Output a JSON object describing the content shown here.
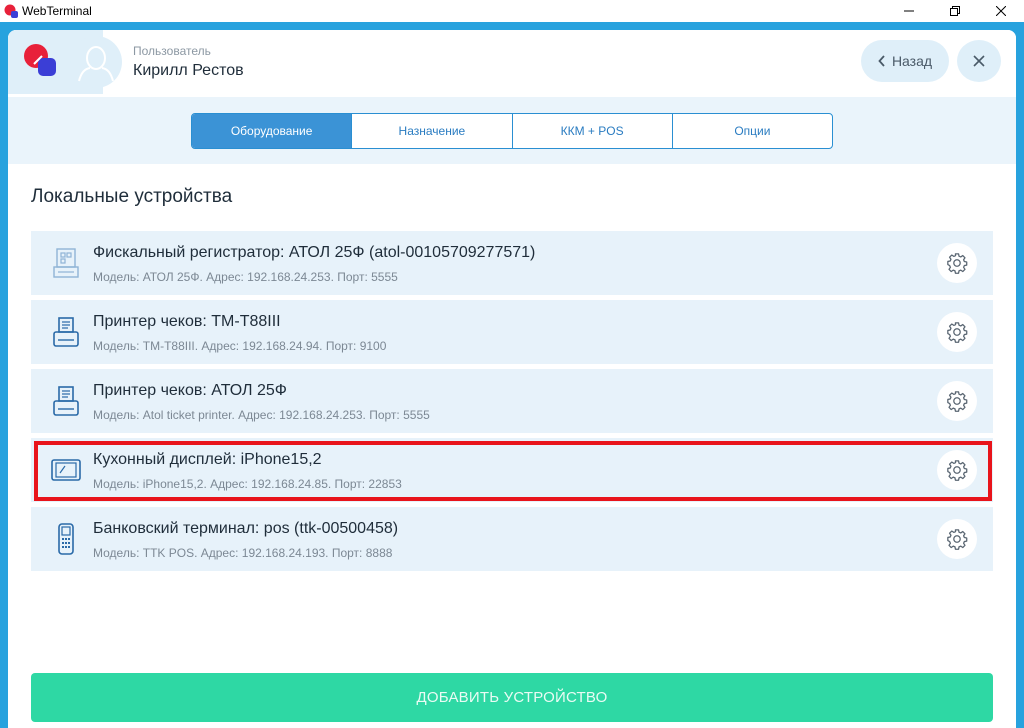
{
  "window": {
    "title": "WebTerminal",
    "minimize_icon": "minimize-icon",
    "maximize_icon": "restore-icon",
    "close_icon": "close-icon"
  },
  "header": {
    "user_label": "Пользователь",
    "user_name": "Кирилл Рестов",
    "back_label": "Назад"
  },
  "tabs": [
    {
      "label": "Оборудование",
      "active": true
    },
    {
      "label": "Назначение",
      "active": false
    },
    {
      "label": "ККМ + POS",
      "active": false
    },
    {
      "label": "Опции",
      "active": false
    }
  ],
  "section": {
    "title": "Локальные устройства"
  },
  "devices": [
    {
      "title": "Фискальный регистратор: АТОЛ 25Ф (atol-00105709277571)",
      "subtitle": "Модель: АТОЛ 25Ф. Адрес: 192.168.24.253. Порт: 5555",
      "icon": "fiscal-register-icon"
    },
    {
      "title": "Принтер чеков: TM-T88III",
      "subtitle": "Модель: TM-T88III. Адрес: 192.168.24.94. Порт: 9100",
      "icon": "receipt-printer-icon"
    },
    {
      "title": "Принтер чеков: АТОЛ 25Ф",
      "subtitle": "Модель: Atol ticket printer. Адрес: 192.168.24.253. Порт: 5555",
      "icon": "receipt-printer-icon"
    },
    {
      "title": "Кухонный дисплей: iPhone15,2",
      "subtitle": "Модель: iPhone15,2. Адрес: 192.168.24.85. Порт: 22853",
      "icon": "tablet-icon"
    },
    {
      "title": "Банковский терминал: pos (ttk-00500458)",
      "subtitle": "Модель: TTK POS. Адрес: 192.168.24.193. Порт: 8888",
      "icon": "payment-terminal-icon"
    }
  ],
  "add_button": {
    "label": "ДОБАВИТЬ УСТРОЙСТВО"
  },
  "colors": {
    "frame": "#27a2de",
    "tab_active": "#3b93d6",
    "row_background": "#e7f2fa",
    "add_button": "#2ed8a4",
    "highlight": "#e8141b"
  }
}
